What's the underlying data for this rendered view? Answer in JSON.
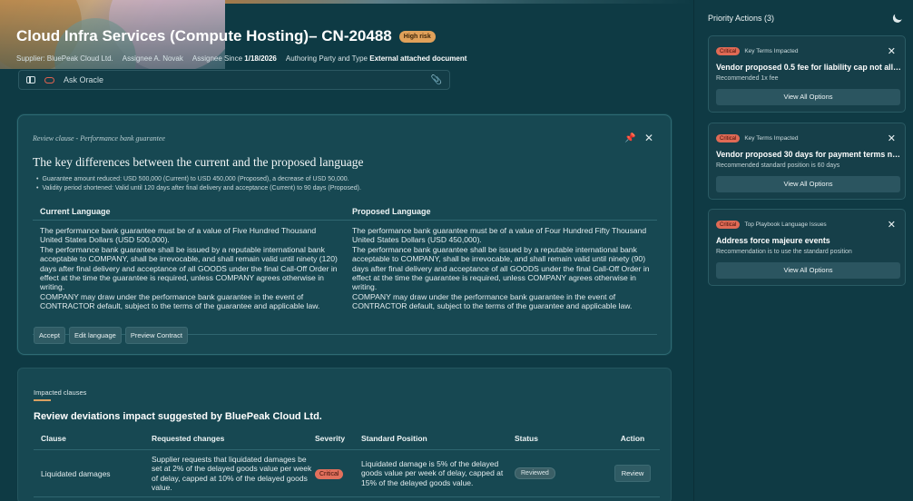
{
  "header": {
    "eyebrow": "",
    "title": "Cloud Infra Services (Compute Hosting)– CN-20488",
    "risk_badge": "High risk",
    "meta": {
      "supplier_label": "Supplier: BluePeak Cloud Ltd.",
      "assignee_label": "Assignee A. Novak",
      "assignee_since_label": "Assignee Since",
      "assignee_since_value": "1/18/2026",
      "authoring_label": "Authoring Party and Type",
      "authoring_value": "External attached document"
    }
  },
  "ask_bar": {
    "label": "Ask Oracle"
  },
  "review_card": {
    "context": "Review clause - Performance bank guarantee",
    "heading": "The key differences between the current and the proposed language",
    "bullets": [
      "Guarantee amount reduced: USD 500,000 (Current) to USD 450,000 (Proposed), a decrease of USD 50,000.",
      "Validity period shortened: Valid until 120 days after final delivery and acceptance (Current) to 90 days (Proposed)."
    ],
    "current_header": "Current Language",
    "proposed_header": "Proposed Language",
    "current_text": "The performance bank guarantee must be of a value of Five Hundred Thousand United States Dollars (USD 500,000).\nThe performance bank guarantee shall be issued by a reputable international bank acceptable to COMPANY, shall be irrevocable, and shall remain valid until ninety (120) days after final delivery and acceptance of all GOODS under the final Call-Off Order in effect at the time the guarantee is required, unless COMPANY agrees otherwise in writing.\nCOMPANY may draw under the performance bank guarantee in the event of CONTRACTOR default, subject to the terms of the guarantee and applicable law.",
    "proposed_text": "The performance bank guarantee must be of a value of Four Hundred Fifty Thousand United States Dollars (USD 450,000).\nThe performance bank guarantee shall be issued by a reputable international bank acceptable to COMPANY, shall be irrevocable, and shall remain valid until ninety (90) days after final delivery and acceptance of all GOODS under the final Call-Off Order in effect at the time the guarantee is required, unless COMPANY agrees otherwise in writing.\nCOMPANY may draw under the performance bank guarantee in the event of CONTRACTOR default, subject to the terms of the guarantee and applicable law.",
    "actions": {
      "accept": "Accept",
      "edit": "Edit language",
      "preview": "Preview Contract"
    }
  },
  "impact": {
    "tab": "Impacted clauses",
    "heading": "Review deviations impact suggested by BluePeak Cloud Ltd.",
    "columns": [
      "Clause",
      "Requested changes",
      "Severity",
      "Standard Position",
      "Status",
      "Action"
    ],
    "rows": [
      {
        "clause": "Liquidated damages",
        "requested": "Supplier requests that liquidated damages be set at 2% of the delayed goods value per week of delay, capped at 10% of the delayed goods value.",
        "severity": "Critical",
        "standard": "Liquidated damage is 5% of the delayed goods value per week of delay, capped at 15% of the delayed goods value.",
        "status": "Reviewed",
        "action": "Review"
      }
    ]
  },
  "sidebar": {
    "title": "Priority Actions (3)",
    "cards": [
      {
        "severity": "Critical",
        "category": "Key Terms Impacted",
        "title": "Vendor proposed 0.5 fee for liability cap not allow...",
        "subtitle": "Recommended 1x fee",
        "button": "View All Options"
      },
      {
        "severity": "Critical",
        "category": "Key Terms Impacted",
        "title": "Vendor proposed 30 days for payment terms not...",
        "subtitle": "Recommended standard position is 60 days",
        "button": "View All Options"
      },
      {
        "severity": "Critical",
        "category": "Top Playbook Language Issues",
        "title": "Address force majeure events",
        "subtitle": "Recommendation is to use the standard position",
        "button": "View All Options"
      }
    ]
  },
  "colors": {
    "background": "#0e3a44",
    "card": "#174852",
    "critical": "#e2705c",
    "high_risk": "#e0a15a"
  }
}
